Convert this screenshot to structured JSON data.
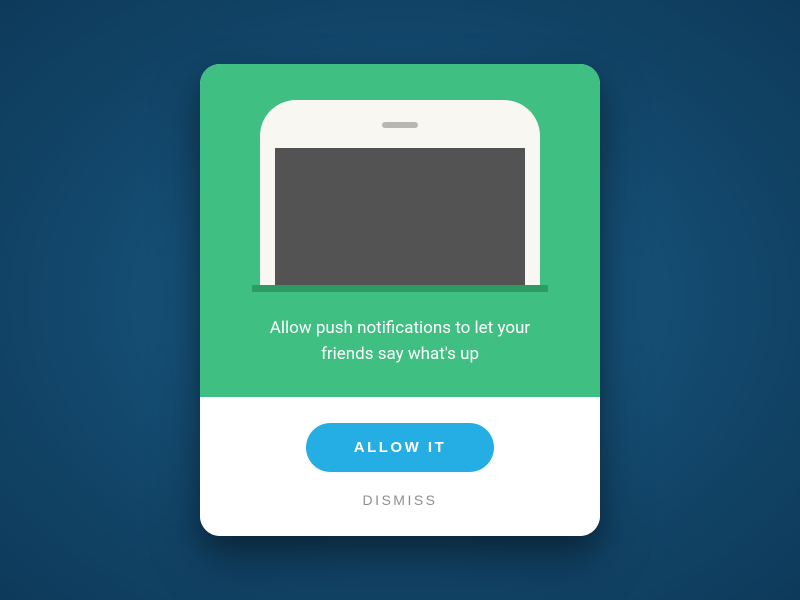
{
  "modal": {
    "message": "Allow push notifications to let your friends say what's up",
    "allow_label": "ALLOW IT",
    "dismiss_label": "DISMISS"
  },
  "colors": {
    "hero_bg": "#3fbf82",
    "shelf": "#2e9a63",
    "primary_button": "#24aee4",
    "screen": "#535353",
    "background": "#114366"
  }
}
